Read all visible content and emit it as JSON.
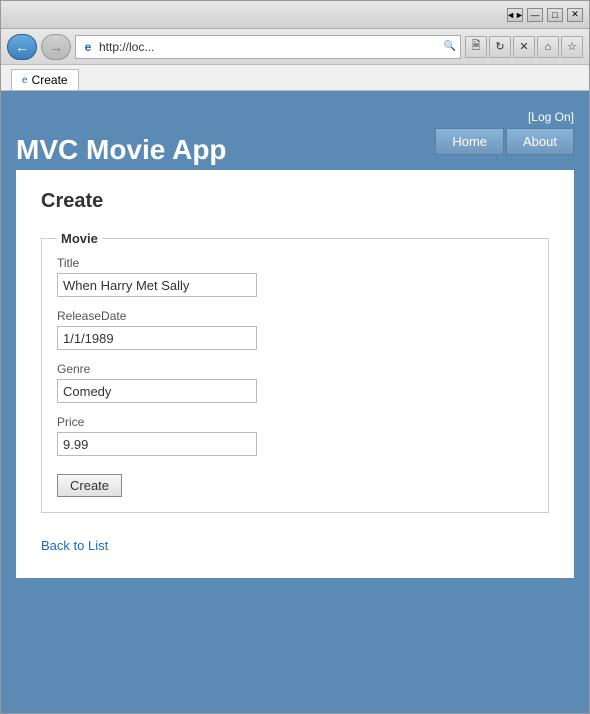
{
  "browser": {
    "address": "http://loc... ",
    "tab_title": "Create",
    "title_buttons": [
      "◄►",
      "—",
      "□",
      "✕"
    ],
    "toolbar_icons": [
      "🗎",
      "↻",
      "✕"
    ],
    "home_icon": "⌂",
    "star_icon": "☆"
  },
  "site": {
    "title": "MVC Movie App",
    "login_prefix": "[ ",
    "login_label": "Log On",
    "login_suffix": " ]",
    "nav": {
      "home_label": "Home",
      "about_label": "About"
    }
  },
  "page": {
    "heading": "Create",
    "fieldset_legend": "Movie",
    "fields": {
      "title_label": "Title",
      "title_value": "When Harry Met Sally",
      "release_label": "ReleaseDate",
      "release_value": "1/1/1989",
      "genre_label": "Genre",
      "genre_value": "Comedy",
      "price_label": "Price",
      "price_value": "9.99"
    },
    "submit_label": "Create",
    "back_link": "Back to List"
  }
}
